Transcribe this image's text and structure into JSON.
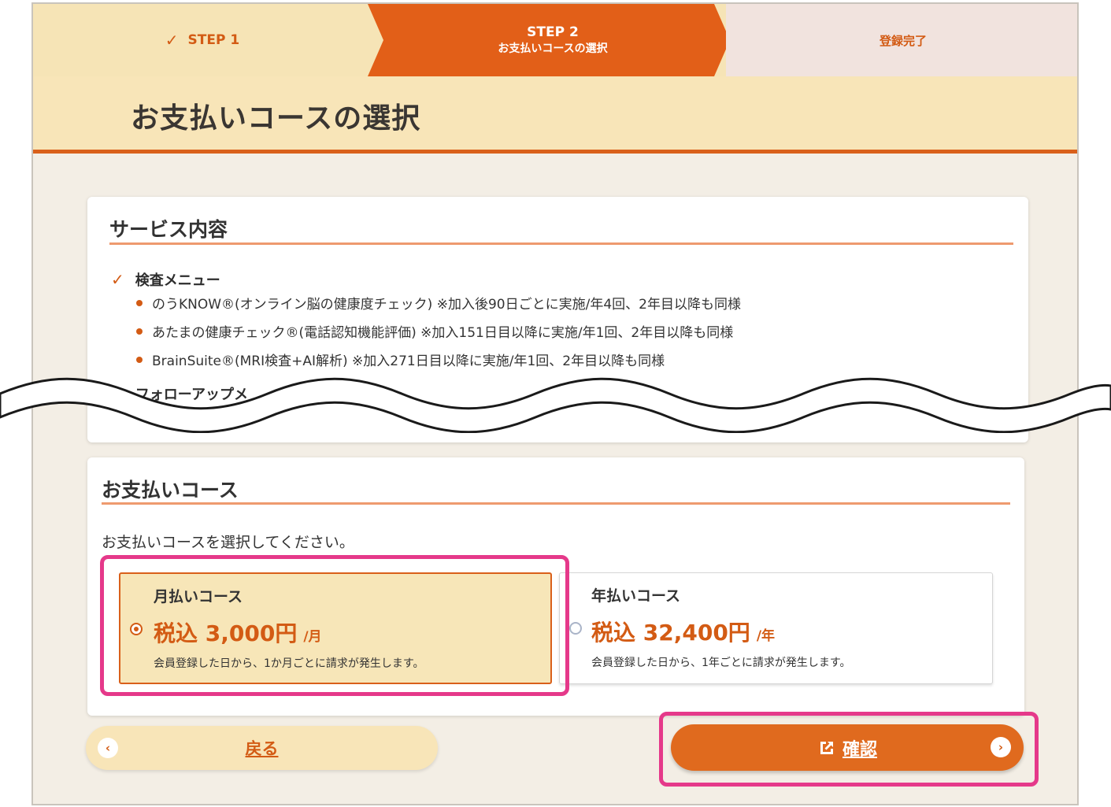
{
  "steps": {
    "step1_label": "STEP 1",
    "step2_label": "STEP 2",
    "step2_sub": "お支払いコースの選択",
    "step3_label": "登録完了"
  },
  "page": {
    "title": "お支払いコースの選択"
  },
  "service": {
    "heading": "サービス内容",
    "menu_title": "検査メニュー",
    "items": [
      "のうKNOW®(オンライン脳の健康度チェック) ※加入後90日ごとに実施/年4回、2年目以降も同様",
      "あたまの健康チェック®(電話認知機能評価) ※加入151日目以降に実施/年1回、2年目以降も同様",
      "BrainSuite®(MRI検査+AI解析) ※加入271日目以降に実施/年1回、2年目以降も同様"
    ],
    "next_title_partial": "フォローアップメ"
  },
  "payment": {
    "heading": "お支払いコース",
    "instruction": "お支払いコースを選択してください。",
    "options": [
      {
        "name": "月払いコース",
        "price": "税込 3,000円",
        "unit": "/月",
        "desc": "会員登録した日から、1か月ごとに請求が発生します。",
        "selected": true
      },
      {
        "name": "年払いコース",
        "price": "税込 32,400円",
        "unit": "/年",
        "desc": "会員登録した日から、1年ごとに請求が発生します。",
        "selected": false
      }
    ]
  },
  "buttons": {
    "back": "戻る",
    "confirm": "確認"
  },
  "colors": {
    "accent": "#d35b14",
    "highlight": "#e5398a",
    "cream": "#f8e5b8"
  }
}
